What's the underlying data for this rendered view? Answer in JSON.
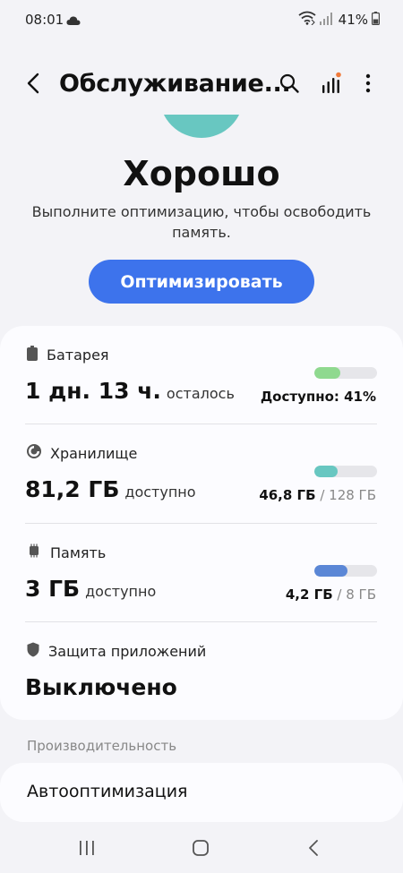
{
  "status_bar": {
    "time": "08:01",
    "battery": "41%",
    "icons": [
      "cloud-icon",
      "wifi-icon",
      "cellular-icon",
      "battery-icon"
    ]
  },
  "app_bar": {
    "title": "Обслуживание...",
    "icons": [
      "back-icon",
      "search-icon",
      "signal-bars-icon",
      "more-icon"
    ],
    "notification_dot_color": "#f07a3a"
  },
  "hero": {
    "headline": "Хорошо",
    "description": "Выполните оптимизацию, чтобы освободить память.",
    "button_label": "Оптимизировать",
    "arc_color": "#68c7c1",
    "button_color": "#3d73ec"
  },
  "sections": {
    "battery": {
      "label": "Батарея",
      "value": "1 дн. 13 ч.",
      "suffix": "осталось",
      "side_text": "Доступно: 41%",
      "fill_percent": 41,
      "bar_color": "#8fd98f"
    },
    "storage": {
      "label": "Хранилище",
      "value": "81,2 ГБ",
      "suffix": "доступно",
      "used": "46,8 ГБ",
      "total": "/ 128 ГБ",
      "fill_percent": 37,
      "bar_color": "#68c7c1"
    },
    "memory": {
      "label": "Память",
      "value": "3 ГБ",
      "suffix": "доступно",
      "used": "4,2 ГБ",
      "total": "/ 8 ГБ",
      "fill_percent": 53,
      "bar_color": "#5b87d6"
    },
    "app_protection": {
      "label": "Защита приложений",
      "value": "Выключено"
    }
  },
  "performance": {
    "category": "Производительность",
    "auto_optimization": "Автооптимизация"
  },
  "nav_bar": {
    "icons": [
      "recents-icon",
      "home-icon",
      "back-nav-icon"
    ]
  }
}
